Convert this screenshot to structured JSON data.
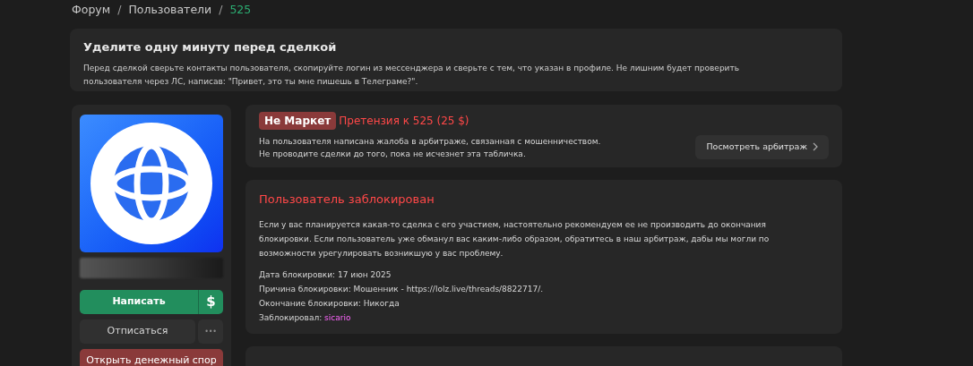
{
  "breadcrumbs": [
    {
      "label": "Форум",
      "current": false,
      "separator": "/"
    },
    {
      "label": "Пользователи",
      "current": false,
      "separator": "/"
    },
    {
      "label": "525",
      "current": true
    }
  ],
  "notice": {
    "title": "Уделите одну минуту перед сделкой",
    "text": "Перед сделкой сверьте контакты пользователя, скопируйте логин из мессенджера и сверьте с тем, что указан в профиле. Не лишним будет проверить пользователя через ЛС, написав: \"Привет, это ты мне пишешь в Телеграме?\"."
  },
  "profile": {
    "buttons": [
      {
        "kind": "primary",
        "label": "Написать"
      },
      {
        "kind": "primary-icon",
        "label": "$"
      },
      {
        "kind": "secondary",
        "label": "Отписаться"
      },
      {
        "kind": "more",
        "label": "•••"
      },
      {
        "kind": "danger",
        "label": "Открыть денежный спор"
      }
    ]
  },
  "claim": {
    "badge": "Не Маркет",
    "title": "Претензия к 525 (25 $)",
    "lines": [
      "На пользователя написана жалоба в арбитраже, связанная с мошенничеством.",
      "Не проводите сделки до того, пока не исчезнет эта табличка."
    ],
    "button": "Посмотреть арбитраж"
  },
  "ban": {
    "title": "Пользователь заблокирован",
    "text": "Если у вас планируется какая-то сделка с его участием, настоятельно рекомендуем ее не производить до окончания блокировки. Если пользователь уже обманул вас каким-либо образом, обратитесь в наш арбитраж, дабы мы могли по возможности урегулировать возникшую у вас проблему.",
    "details": [
      {
        "label": "Дата блокировки:",
        "value": "17 июн 2025",
        "kind": "plain"
      },
      {
        "label": "Причина блокировки:",
        "value": "Мошенник - https://lolz.live/threads/8822717/.",
        "kind": "plain"
      },
      {
        "label": "Окончание блокировки:",
        "value": "Никогда",
        "kind": "plain"
      },
      {
        "label": "Заблокировал:",
        "value": "sicario",
        "kind": "user"
      }
    ]
  }
}
